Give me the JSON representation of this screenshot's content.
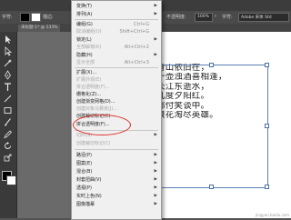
{
  "control_bar": {
    "object_type": "字符:",
    "stroke_label": "描边:",
    "opacity_label": "不透明度:",
    "opacity_value": "100%",
    "font_name": "Adobe 宋体 Std"
  },
  "doc_tab": "未标题-1* @ 133%",
  "menu": {
    "items": [
      {
        "label": "变换(T)",
        "shortcut": "",
        "arrow": "▶",
        "disabled": false
      },
      {
        "label": "排列(A)",
        "shortcut": "",
        "arrow": "▶",
        "disabled": false
      },
      {
        "label": "编组(G)",
        "shortcut": "Ctrl+G",
        "arrow": "",
        "disabled": false
      },
      {
        "label": "取消编组(U)",
        "shortcut": "Shift+Ctrl+G",
        "arrow": "",
        "disabled": true
      },
      {
        "label": "锁定(L)",
        "shortcut": "",
        "arrow": "▶",
        "disabled": false
      },
      {
        "label": "全部解锁(K)",
        "shortcut": "Alt+Ctrl+2",
        "arrow": "",
        "disabled": true
      },
      {
        "label": "隐藏(H)",
        "shortcut": "",
        "arrow": "▶",
        "disabled": false
      },
      {
        "label": "显示全部",
        "shortcut": "Alt+Ctrl+3",
        "arrow": "",
        "disabled": true
      },
      {
        "label": "扩展(X)...",
        "shortcut": "",
        "arrow": "",
        "disabled": false
      },
      {
        "label": "扩展外观(E)",
        "shortcut": "",
        "arrow": "",
        "disabled": true
      },
      {
        "label": "拼合透明度(F)...",
        "shortcut": "",
        "arrow": "",
        "disabled": false
      },
      {
        "label": "栅格化(Z)...",
        "shortcut": "",
        "arrow": "",
        "disabled": false
      },
      {
        "label": "创建渐变网格(D)...",
        "shortcut": "",
        "arrow": "",
        "disabled": false
      },
      {
        "label": "创建对象马赛克(J)...",
        "shortcut": "",
        "arrow": "",
        "disabled": true
      },
      {
        "label": "创建裁切标记(C)",
        "shortcut": "",
        "arrow": "",
        "disabled": false
      },
      {
        "label": "拼合透明度(F)...",
        "shortcut": "",
        "arrow": "",
        "disabled": false
      },
      {
        "label": "切片(S)",
        "shortcut": "",
        "arrow": "▶",
        "disabled": true
      },
      {
        "label": "创建裁切标记(C)",
        "shortcut": "",
        "arrow": "",
        "disabled": true
      },
      {
        "label": "路径(P)",
        "shortcut": "",
        "arrow": "▶",
        "disabled": false
      },
      {
        "label": "图案(E)",
        "shortcut": "",
        "arrow": "▶",
        "disabled": false
      },
      {
        "label": "混合(B)",
        "shortcut": "",
        "arrow": "▶",
        "disabled": false
      },
      {
        "label": "封套扭曲(V)",
        "shortcut": "",
        "arrow": "▶",
        "disabled": false
      },
      {
        "label": "透视(P)",
        "shortcut": "",
        "arrow": "▶",
        "disabled": false
      },
      {
        "label": "实时上色(N)",
        "shortcut": "",
        "arrow": "▶",
        "disabled": false
      },
      {
        "label": "图像描摹",
        "shortcut": "",
        "arrow": "▶",
        "disabled": false
      }
    ]
  },
  "poem": [
    "青山依旧在，",
    "一壶浊酒喜相逢，",
    "长江东逝水，",
    "几度夕阳红。",
    "都付笑谈中。",
    "浪花淘尽英雄。"
  ],
  "watermark": "jingyan.baidu.com",
  "accent": "#e0302a"
}
